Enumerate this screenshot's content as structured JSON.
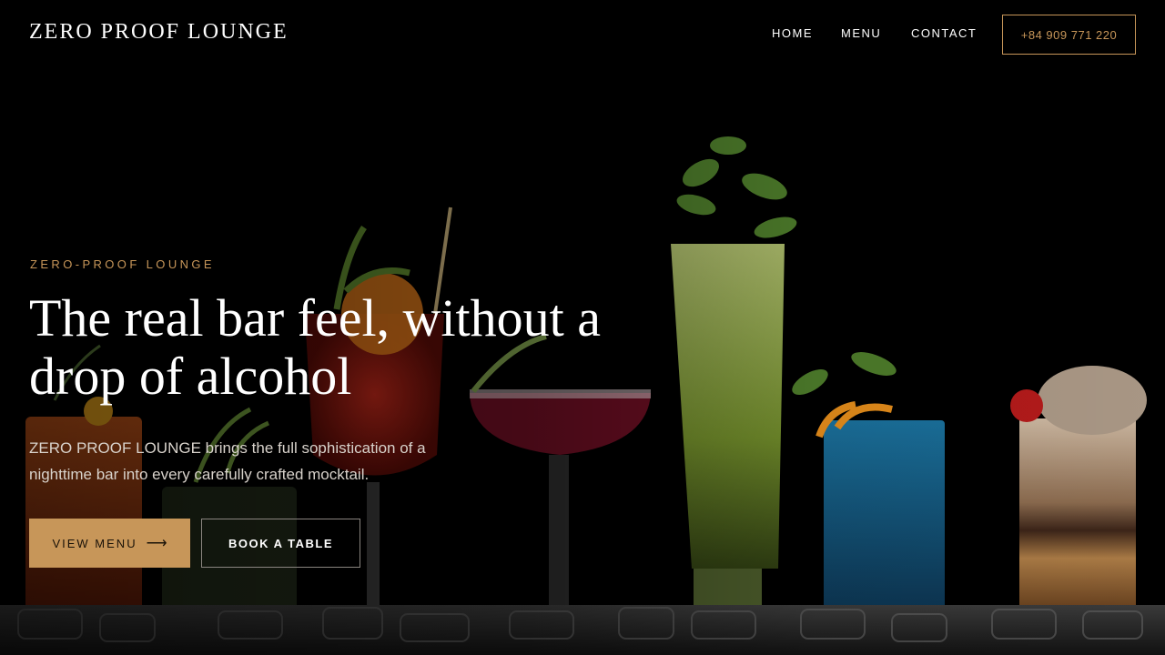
{
  "header": {
    "brand": "ZERO PROOF LOUNGE",
    "nav": [
      {
        "label": "HOME"
      },
      {
        "label": "MENU"
      },
      {
        "label": "CONTACT"
      }
    ],
    "phone": "+84 909 771 220"
  },
  "hero": {
    "eyebrow": "ZERO-PROOF LOUNGE",
    "title": "The real bar feel, without a drop of alcohol",
    "description": "ZERO PROOF LOUNGE brings the full sophistication of a nighttime bar into every carefully crafted mocktail.",
    "primary_button": "VIEW MENU",
    "primary_button_icon": "arrow-right-icon",
    "secondary_button": "BOOK A TABLE"
  },
  "colors": {
    "background": "#000000",
    "accent": "#c79659",
    "text": "#ffffff",
    "muted_text": "#d8d2cb"
  }
}
